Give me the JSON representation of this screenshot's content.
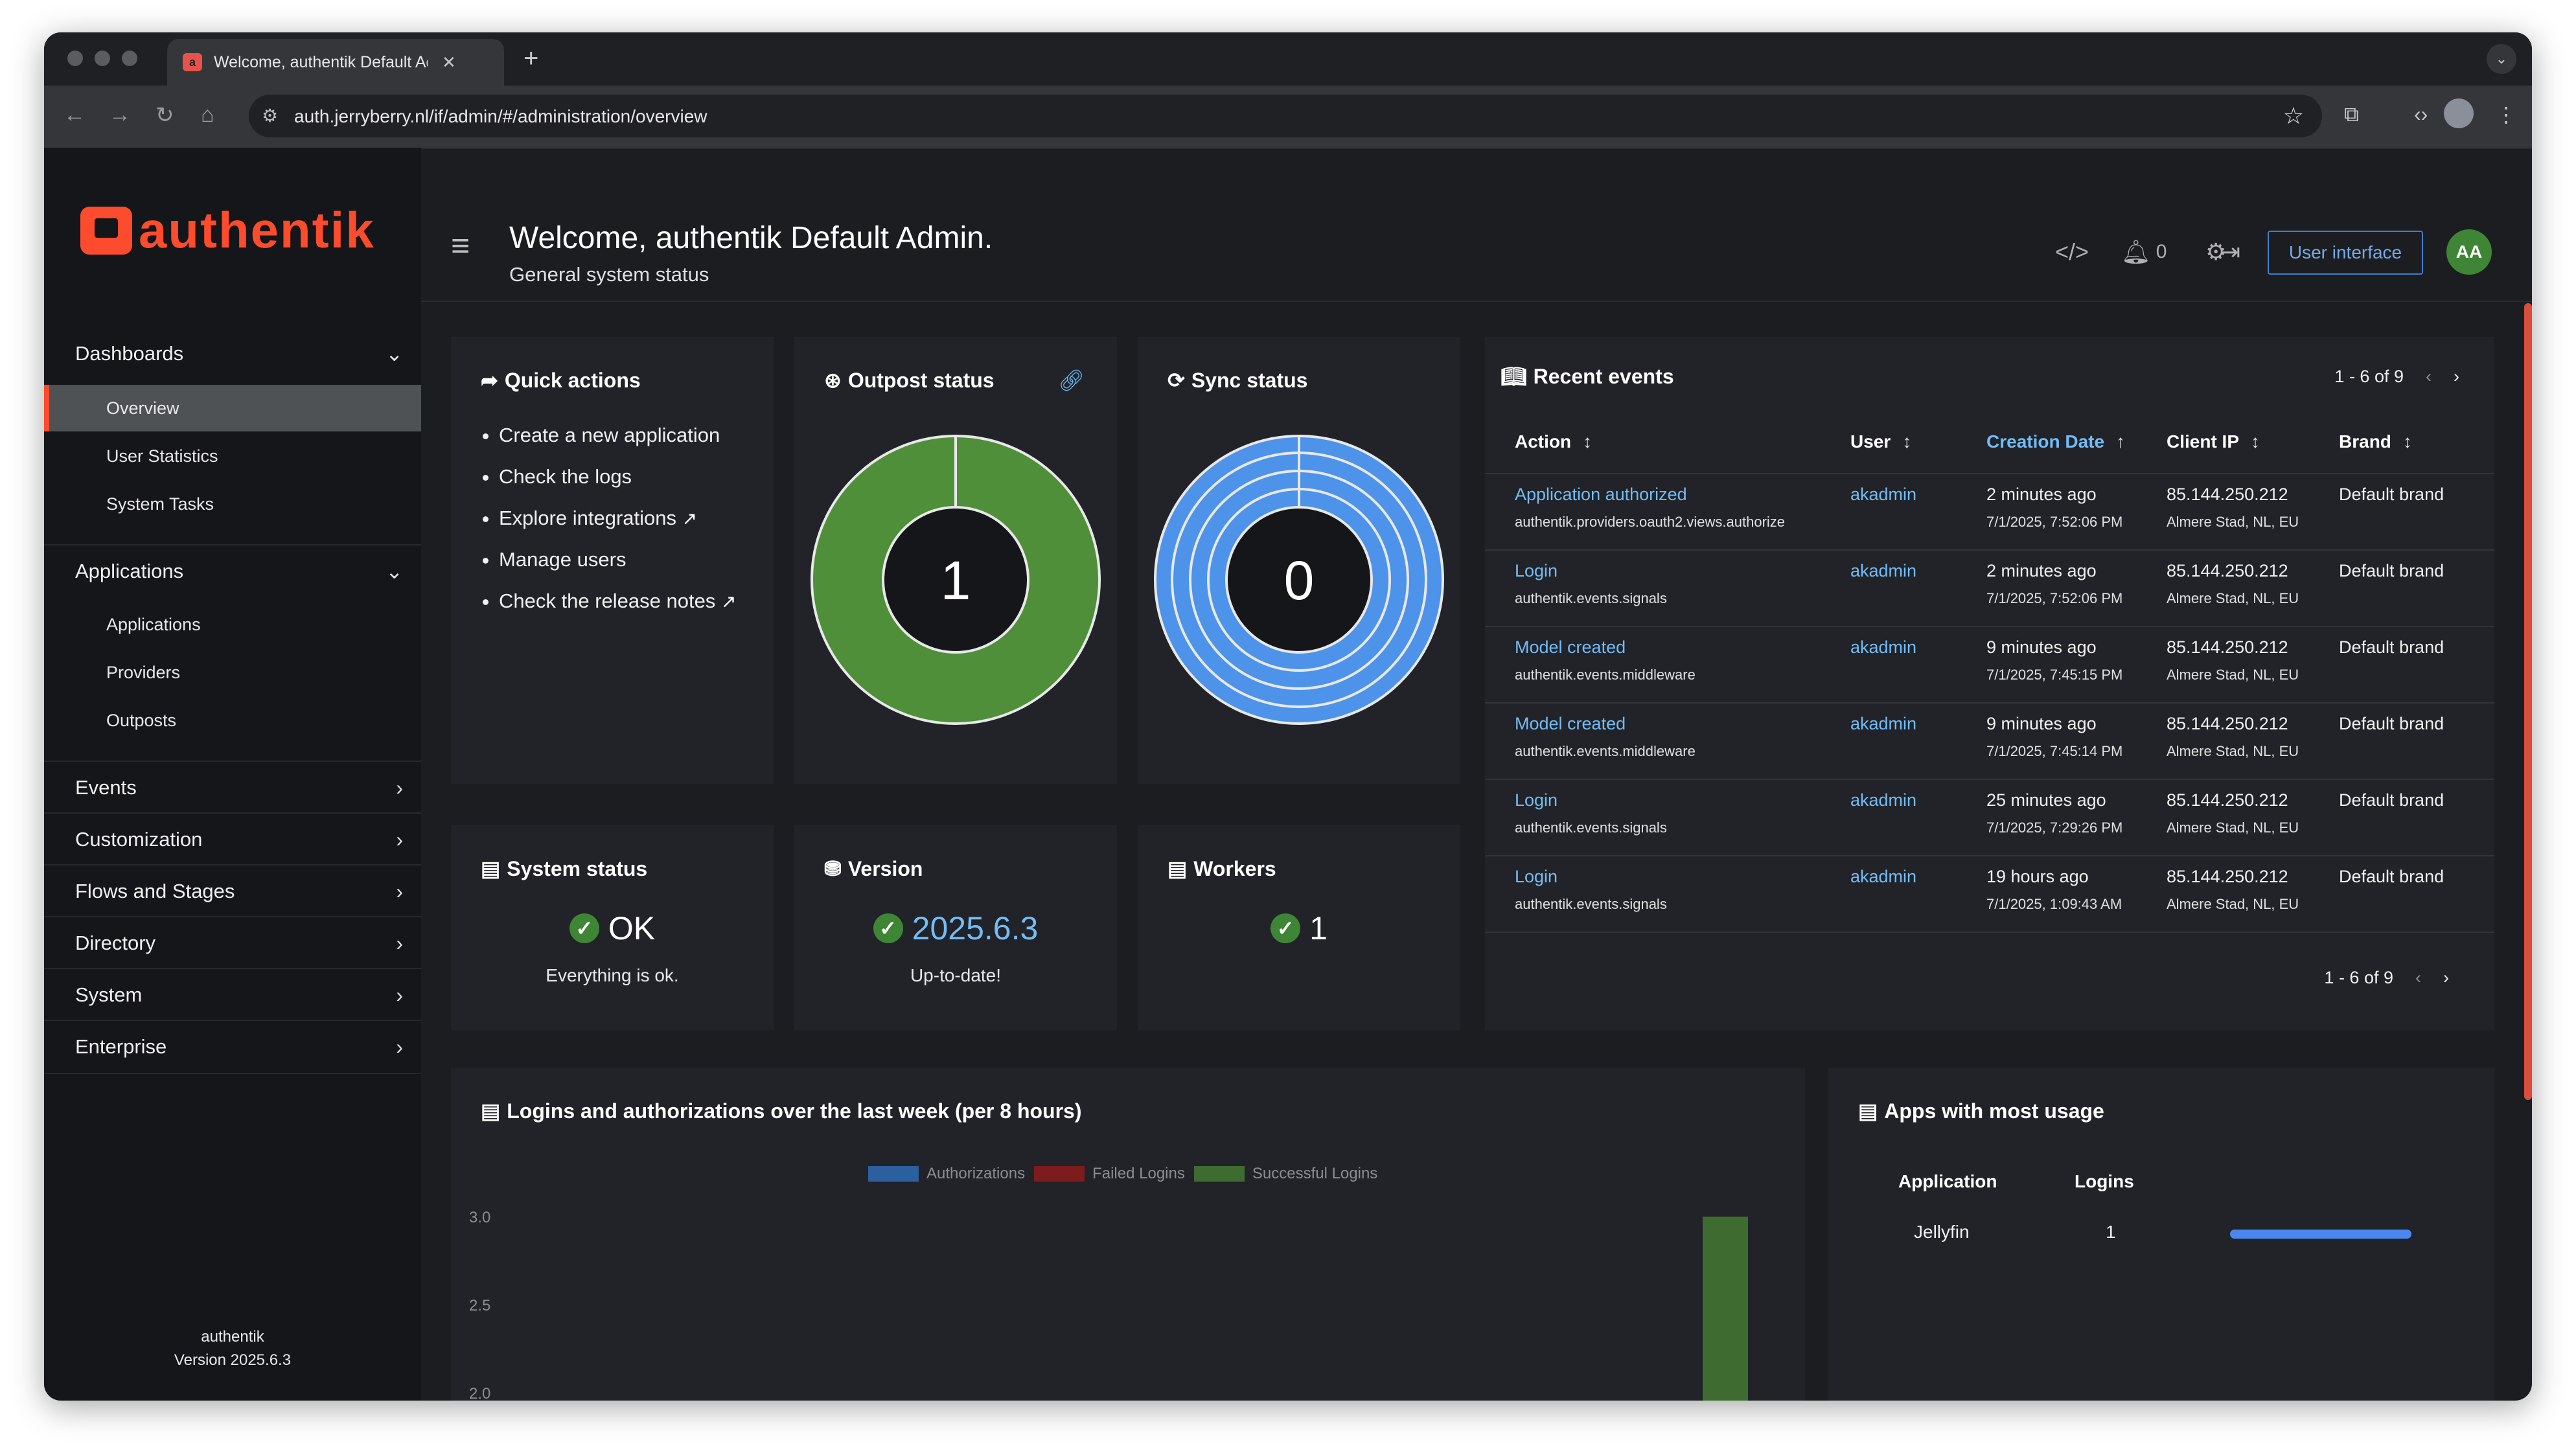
{
  "browser": {
    "tab_title": "Welcome, authentik Default Admin.",
    "url": "auth.jerryberry.nl/if/admin/#/administration/overview"
  },
  "sidebar": {
    "logo_text": "authentik",
    "sections": [
      {
        "label": "Dashboards",
        "expanded": true,
        "items": [
          "Overview",
          "User Statistics",
          "System Tasks"
        ]
      },
      {
        "label": "Applications",
        "expanded": true,
        "items": [
          "Applications",
          "Providers",
          "Outposts"
        ]
      },
      {
        "label": "Events",
        "expanded": false
      },
      {
        "label": "Customization",
        "expanded": false
      },
      {
        "label": "Flows and Stages",
        "expanded": false
      },
      {
        "label": "Directory",
        "expanded": false
      },
      {
        "label": "System",
        "expanded": false
      },
      {
        "label": "Enterprise",
        "expanded": false
      }
    ],
    "active_item": "Overview",
    "footer": {
      "name": "authentik",
      "version": "Version 2025.6.3"
    }
  },
  "header": {
    "title": "Welcome, authentik Default Admin.",
    "subtitle": "General system status",
    "notification_count": "0",
    "user_interface_button": "User interface",
    "avatar_initials": "AA"
  },
  "quick_actions": {
    "title": "Quick actions",
    "items": [
      "Create a new application",
      "Check the logs",
      "Explore integrations",
      "Manage users",
      "Check the release notes"
    ]
  },
  "outpost_status": {
    "title": "Outpost status",
    "value": "1",
    "color": "#4f8f39"
  },
  "sync_status": {
    "title": "Sync status",
    "value": "0",
    "color": "#4d93ea"
  },
  "system_status": {
    "title": "System status",
    "value": "OK",
    "subtitle": "Everything is ok."
  },
  "version": {
    "title": "Version",
    "value": "2025.6.3",
    "subtitle": "Up-to-date!"
  },
  "workers": {
    "title": "Workers",
    "value": "1"
  },
  "recent_events": {
    "title": "Recent events",
    "pagination": "1 - 6 of 9",
    "columns": [
      "Action",
      "User",
      "Creation Date",
      "Client IP",
      "Brand"
    ],
    "rows": [
      {
        "action": "Application authorized",
        "app": "authentik.providers.oauth2.views.authorize",
        "user": "akadmin",
        "when": "2 minutes ago",
        "date": "7/1/2025, 7:52:06 PM",
        "ip": "85.144.250.212",
        "location": "Almere Stad, NL, EU",
        "brand": "Default brand"
      },
      {
        "action": "Login",
        "app": "authentik.events.signals",
        "user": "akadmin",
        "when": "2 minutes ago",
        "date": "7/1/2025, 7:52:06 PM",
        "ip": "85.144.250.212",
        "location": "Almere Stad, NL, EU",
        "brand": "Default brand"
      },
      {
        "action": "Model created",
        "app": "authentik.events.middleware",
        "user": "akadmin",
        "when": "9 minutes ago",
        "date": "7/1/2025, 7:45:15 PM",
        "ip": "85.144.250.212",
        "location": "Almere Stad, NL, EU",
        "brand": "Default brand"
      },
      {
        "action": "Model created",
        "app": "authentik.events.middleware",
        "user": "akadmin",
        "when": "9 minutes ago",
        "date": "7/1/2025, 7:45:14 PM",
        "ip": "85.144.250.212",
        "location": "Almere Stad, NL, EU",
        "brand": "Default brand"
      },
      {
        "action": "Login",
        "app": "authentik.events.signals",
        "user": "akadmin",
        "when": "25 minutes ago",
        "date": "7/1/2025, 7:29:26 PM",
        "ip": "85.144.250.212",
        "location": "Almere Stad, NL, EU",
        "brand": "Default brand"
      },
      {
        "action": "Login",
        "app": "authentik.events.signals",
        "user": "akadmin",
        "when": "19 hours ago",
        "date": "7/1/2025, 1:09:43 AM",
        "ip": "85.144.250.212",
        "location": "Almere Stad, NL, EU",
        "brand": "Default brand"
      }
    ]
  },
  "logins_chart": {
    "title": "Logins and authorizations over the last week (per 8 hours)"
  },
  "chart_data": {
    "type": "bar",
    "title": "Logins and authorizations over the last week (per 8 hours)",
    "series": [
      {
        "name": "Authorizations",
        "color": "#2b5f9e"
      },
      {
        "name": "Failed Logins",
        "color": "#7d1c1c"
      },
      {
        "name": "Successful Logins",
        "color": "#3d6b30",
        "visible_bar_value": 3
      }
    ],
    "y_ticks": [
      "3.0",
      "2.5",
      "2.0"
    ],
    "ylim_visible": [
      2.0,
      3.0
    ],
    "legend_position": "top-center"
  },
  "apps_usage": {
    "title": "Apps with most usage",
    "columns": [
      "Application",
      "Logins"
    ],
    "rows": [
      {
        "app": "Jellyfin",
        "logins": "1",
        "fraction": 1.0
      }
    ]
  }
}
